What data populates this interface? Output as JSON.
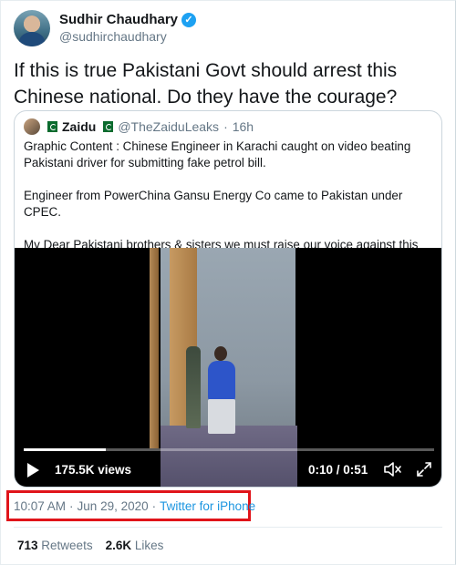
{
  "author": {
    "name": "Sudhir Chaudhary",
    "handle": "@sudhirchaudhary",
    "verified": true
  },
  "tweet": {
    "text": "If this is true Pakistani Govt should arrest this Chinese national. Do they have the courage?"
  },
  "quoted": {
    "name": "Zaidu",
    "handle": "@TheZaiduLeaks",
    "separator": "·",
    "age": "16h",
    "paragraphs": [
      "Graphic Content : Chinese Engineer in Karachi caught on video beating Pakistani driver for submitting fake petrol bill.",
      "Engineer from PowerChina Gansu Energy Co came to Pakistan under CPEC.",
      "My Dear Pakistani brothers & sisters we must raise our voice against this this behaviour"
    ],
    "video": {
      "views": "175.5K views",
      "time": "0:10 / 0:51",
      "progress_fraction": 0.2
    }
  },
  "meta": {
    "time": "10:07 AM",
    "sep1": "·",
    "date": "Jun 29, 2020",
    "sep2": "·",
    "source": "Twitter for iPhone"
  },
  "stats": {
    "retweets_count": "713",
    "retweets_label": "Retweets",
    "likes_count": "2.6K",
    "likes_label": "Likes"
  },
  "colors": {
    "accent": "#1da1f2",
    "link": "#1b95e0",
    "highlight_box": "#e0141a"
  },
  "icons": [
    "verified-badge-icon",
    "more-icon",
    "play-icon",
    "volume-icon",
    "expand-icon",
    "pakistan-flag-icon"
  ]
}
